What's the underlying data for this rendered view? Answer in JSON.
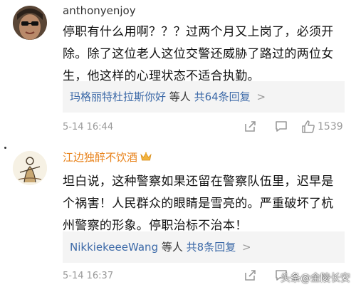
{
  "comments": [
    {
      "username": "anthonyenjoy",
      "text": "停职有什么用啊？？？过两个月又上岗了，必须开除。除了这位老人这位交警还威胁了路过的两位女生，他这样的心理状态不适合执勤。",
      "reply_users": "玛格丽特杜拉斯你好",
      "reply_middle": "等人",
      "reply_count": "共64条回复",
      "reply_chevron": ">",
      "timestamp": "5-14 16:44",
      "like_count": "1539",
      "icons": [
        "share-icon",
        "comment-icon",
        "like-icon"
      ]
    },
    {
      "username": "江边独醉不饮酒",
      "username_color": "#e8821a",
      "badge_icon": "crown-icon",
      "text": "坦白说，这种警察如果还留在警察队伍里，迟早是个祸害！人民群众的眼睛是雪亮的。严重破坏了杭州警察的形象。停职治标不治本！",
      "reply_users": "NikkiekeeeWang",
      "reply_middle": "等人",
      "reply_count": "共8条回复",
      "reply_chevron": ">",
      "timestamp": "5-14 16:37",
      "icons": [
        "share-icon",
        "comment-icon",
        "like-icon"
      ]
    }
  ],
  "watermark": "头条@金陵长安",
  "colors": {
    "link": "#3d6aa8",
    "vip_name": "#e8821a",
    "meta": "#999999",
    "reply_bg": "#f4f4f4"
  }
}
